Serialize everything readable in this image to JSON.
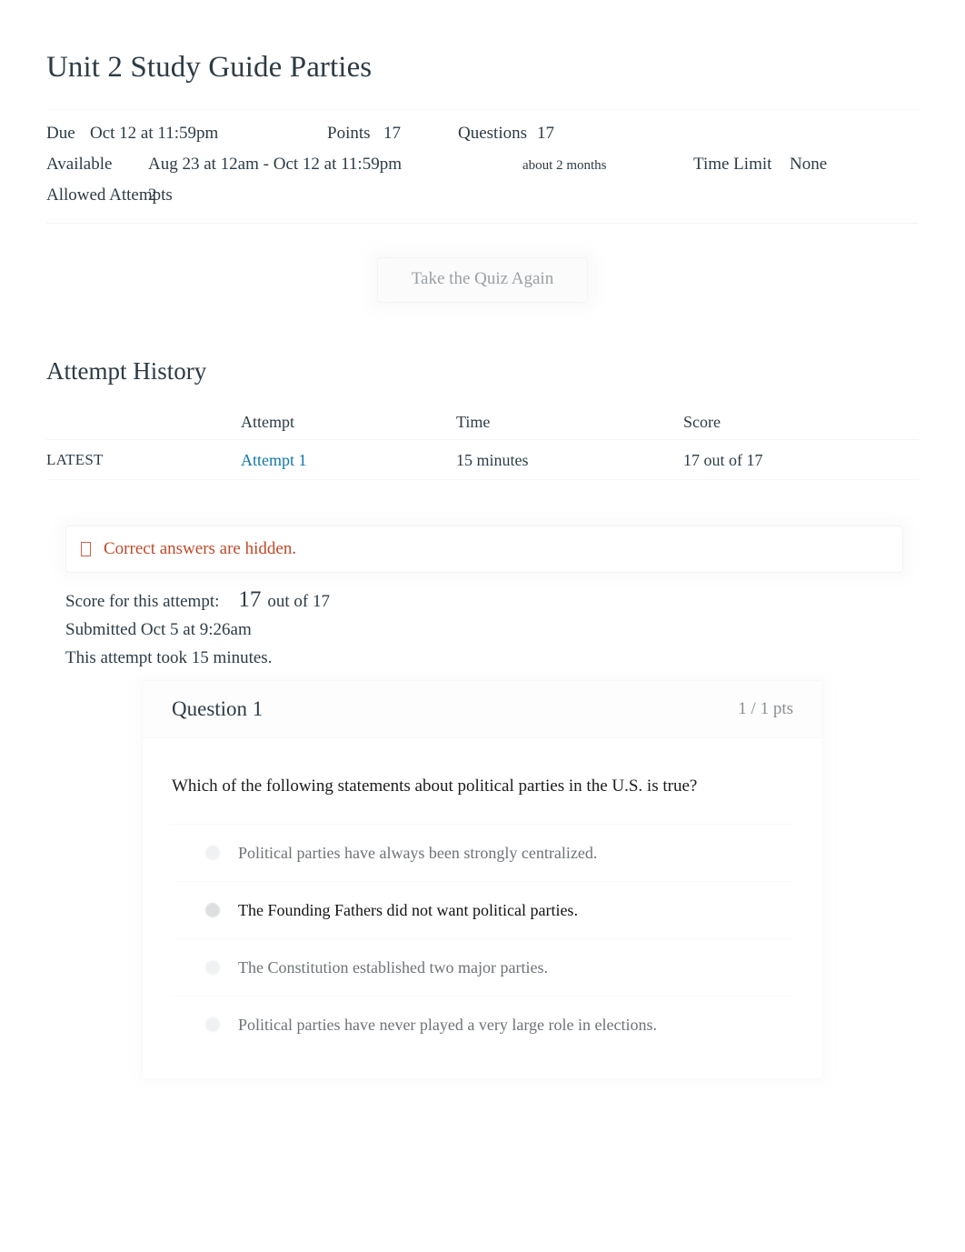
{
  "quiz": {
    "title": "Unit 2 Study Guide Parties",
    "info": {
      "due_label": "Due",
      "due_value": "Oct 12 at 11:59pm",
      "points_label": "Points",
      "points_value": "17",
      "questions_label": "Questions",
      "questions_value": "17",
      "available_label": "Available",
      "available_value": "Aug 23 at 12am - Oct 12 at 11:59pm",
      "available_duration": "about 2 months",
      "time_limit_label": "Time Limit",
      "time_limit_value": "None",
      "allowed_attempts_label": "Allowed Attempts",
      "allowed_attempts_value": "2"
    },
    "retake_button_label": "Take the Quiz Again"
  },
  "attempt_history": {
    "heading": "Attempt History",
    "columns": {
      "blank": "",
      "attempt": "Attempt",
      "time": "Time",
      "score": "Score"
    },
    "rows": [
      {
        "latest_tag": "LATEST",
        "attempt": "Attempt 1",
        "time": "15 minutes",
        "score": "17 out of 17"
      }
    ]
  },
  "alert": {
    "icon": "info-circle-icon",
    "text": "Correct answers are hidden.",
    "color": "#bf4928"
  },
  "attempt_summary": {
    "score_label": "Score for this attempt:",
    "score_value": "17",
    "score_suffix": "out of 17",
    "submitted": "Submitted Oct 5 at 9:26am",
    "duration": "This attempt took 15 minutes."
  },
  "question": {
    "name": "Question 1",
    "points": "1 / 1 pts",
    "text": "Which of the following statements about political parties in the U.S. is true?",
    "answers": [
      {
        "label": "Political parties have always been strongly centralized.",
        "selected": false
      },
      {
        "label": "The Founding Fathers did not want political parties.",
        "selected": true
      },
      {
        "label": "The Constitution established two major parties.",
        "selected": false
      },
      {
        "label": "Political parties have never played a very large role in elections.",
        "selected": false
      }
    ]
  },
  "colors": {
    "link": "#1076a8",
    "alert": "#bf4928",
    "text": "#2d3b45",
    "muted": "#6e7377"
  }
}
